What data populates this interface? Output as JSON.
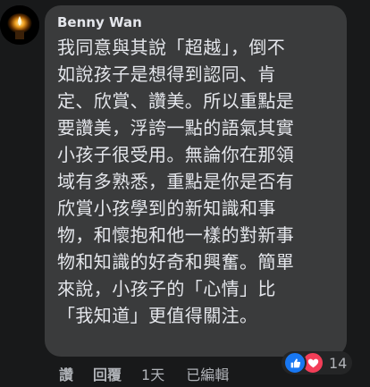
{
  "comment": {
    "author": "Benny Wan",
    "lines": [
      "我同意與其說「超越」，倒不",
      "如說孩子是想得到認同、肯",
      "定、欣賞、讚美。所以重點是",
      "要讚美，浮誇一點的語氣其實",
      "小孩子很受用。無論你在那領",
      "域有多熟悉，重點是你是否有",
      "欣賞小孩學到的新知識和事",
      "物，和懷抱和他一樣的對新事",
      "物和知識的好奇和興奮。簡單",
      "來說，小孩子的「心情」比",
      "「我知道」更值得關注。"
    ]
  },
  "actions": {
    "like_label": "讚",
    "reply_label": "回覆",
    "timestamp": "1天",
    "edited_label": "已編輯"
  },
  "reactions": {
    "count": "14",
    "icons": [
      "like-icon",
      "love-icon"
    ],
    "like_color": "#1877f2",
    "love_color": "#f33e58"
  },
  "colors": {
    "background": "#18191a",
    "bubble": "#3a3b3c",
    "text": "#e4e6eb",
    "secondary_text": "#b0b3b8"
  }
}
